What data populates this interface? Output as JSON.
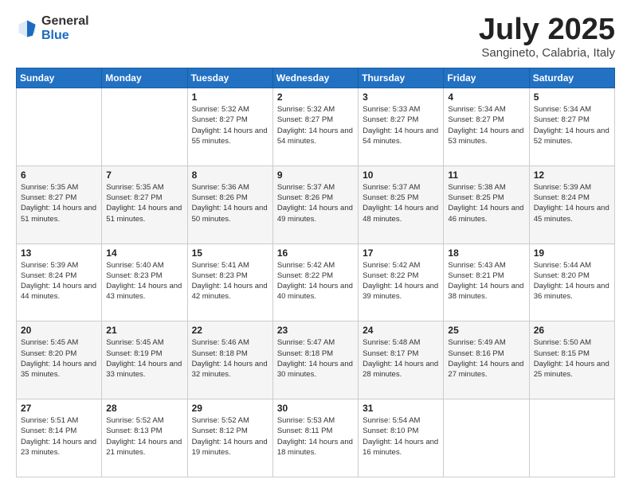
{
  "header": {
    "logo_general": "General",
    "logo_blue": "Blue",
    "month": "July 2025",
    "location": "Sangineto, Calabria, Italy"
  },
  "days_of_week": [
    "Sunday",
    "Monday",
    "Tuesday",
    "Wednesday",
    "Thursday",
    "Friday",
    "Saturday"
  ],
  "weeks": [
    [
      {
        "day": "",
        "info": ""
      },
      {
        "day": "",
        "info": ""
      },
      {
        "day": "1",
        "info": "Sunrise: 5:32 AM\nSunset: 8:27 PM\nDaylight: 14 hours and 55 minutes."
      },
      {
        "day": "2",
        "info": "Sunrise: 5:32 AM\nSunset: 8:27 PM\nDaylight: 14 hours and 54 minutes."
      },
      {
        "day": "3",
        "info": "Sunrise: 5:33 AM\nSunset: 8:27 PM\nDaylight: 14 hours and 54 minutes."
      },
      {
        "day": "4",
        "info": "Sunrise: 5:34 AM\nSunset: 8:27 PM\nDaylight: 14 hours and 53 minutes."
      },
      {
        "day": "5",
        "info": "Sunrise: 5:34 AM\nSunset: 8:27 PM\nDaylight: 14 hours and 52 minutes."
      }
    ],
    [
      {
        "day": "6",
        "info": "Sunrise: 5:35 AM\nSunset: 8:27 PM\nDaylight: 14 hours and 51 minutes."
      },
      {
        "day": "7",
        "info": "Sunrise: 5:35 AM\nSunset: 8:27 PM\nDaylight: 14 hours and 51 minutes."
      },
      {
        "day": "8",
        "info": "Sunrise: 5:36 AM\nSunset: 8:26 PM\nDaylight: 14 hours and 50 minutes."
      },
      {
        "day": "9",
        "info": "Sunrise: 5:37 AM\nSunset: 8:26 PM\nDaylight: 14 hours and 49 minutes."
      },
      {
        "day": "10",
        "info": "Sunrise: 5:37 AM\nSunset: 8:25 PM\nDaylight: 14 hours and 48 minutes."
      },
      {
        "day": "11",
        "info": "Sunrise: 5:38 AM\nSunset: 8:25 PM\nDaylight: 14 hours and 46 minutes."
      },
      {
        "day": "12",
        "info": "Sunrise: 5:39 AM\nSunset: 8:24 PM\nDaylight: 14 hours and 45 minutes."
      }
    ],
    [
      {
        "day": "13",
        "info": "Sunrise: 5:39 AM\nSunset: 8:24 PM\nDaylight: 14 hours and 44 minutes."
      },
      {
        "day": "14",
        "info": "Sunrise: 5:40 AM\nSunset: 8:23 PM\nDaylight: 14 hours and 43 minutes."
      },
      {
        "day": "15",
        "info": "Sunrise: 5:41 AM\nSunset: 8:23 PM\nDaylight: 14 hours and 42 minutes."
      },
      {
        "day": "16",
        "info": "Sunrise: 5:42 AM\nSunset: 8:22 PM\nDaylight: 14 hours and 40 minutes."
      },
      {
        "day": "17",
        "info": "Sunrise: 5:42 AM\nSunset: 8:22 PM\nDaylight: 14 hours and 39 minutes."
      },
      {
        "day": "18",
        "info": "Sunrise: 5:43 AM\nSunset: 8:21 PM\nDaylight: 14 hours and 38 minutes."
      },
      {
        "day": "19",
        "info": "Sunrise: 5:44 AM\nSunset: 8:20 PM\nDaylight: 14 hours and 36 minutes."
      }
    ],
    [
      {
        "day": "20",
        "info": "Sunrise: 5:45 AM\nSunset: 8:20 PM\nDaylight: 14 hours and 35 minutes."
      },
      {
        "day": "21",
        "info": "Sunrise: 5:45 AM\nSunset: 8:19 PM\nDaylight: 14 hours and 33 minutes."
      },
      {
        "day": "22",
        "info": "Sunrise: 5:46 AM\nSunset: 8:18 PM\nDaylight: 14 hours and 32 minutes."
      },
      {
        "day": "23",
        "info": "Sunrise: 5:47 AM\nSunset: 8:18 PM\nDaylight: 14 hours and 30 minutes."
      },
      {
        "day": "24",
        "info": "Sunrise: 5:48 AM\nSunset: 8:17 PM\nDaylight: 14 hours and 28 minutes."
      },
      {
        "day": "25",
        "info": "Sunrise: 5:49 AM\nSunset: 8:16 PM\nDaylight: 14 hours and 27 minutes."
      },
      {
        "day": "26",
        "info": "Sunrise: 5:50 AM\nSunset: 8:15 PM\nDaylight: 14 hours and 25 minutes."
      }
    ],
    [
      {
        "day": "27",
        "info": "Sunrise: 5:51 AM\nSunset: 8:14 PM\nDaylight: 14 hours and 23 minutes."
      },
      {
        "day": "28",
        "info": "Sunrise: 5:52 AM\nSunset: 8:13 PM\nDaylight: 14 hours and 21 minutes."
      },
      {
        "day": "29",
        "info": "Sunrise: 5:52 AM\nSunset: 8:12 PM\nDaylight: 14 hours and 19 minutes."
      },
      {
        "day": "30",
        "info": "Sunrise: 5:53 AM\nSunset: 8:11 PM\nDaylight: 14 hours and 18 minutes."
      },
      {
        "day": "31",
        "info": "Sunrise: 5:54 AM\nSunset: 8:10 PM\nDaylight: 14 hours and 16 minutes."
      },
      {
        "day": "",
        "info": ""
      },
      {
        "day": "",
        "info": ""
      }
    ]
  ]
}
